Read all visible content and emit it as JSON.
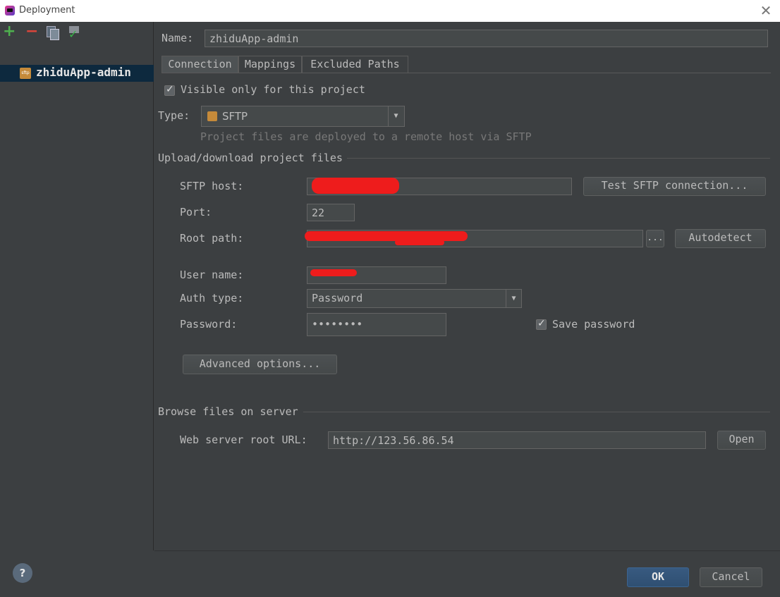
{
  "window": {
    "title": "Deployment",
    "close_glyph": "✕"
  },
  "left": {
    "toolbar": [
      "add-icon",
      "remove-icon",
      "copy-icon",
      "use-as-default-icon"
    ],
    "server_item": {
      "label": "zhiduApp-admin",
      "icon": "sftp-server-icon",
      "icon_text": "sftp"
    }
  },
  "name": {
    "label": "Name:",
    "value": "zhiduApp-admin"
  },
  "tabs": [
    {
      "label": "Connection",
      "active": true
    },
    {
      "label": "Mappings",
      "active": false
    },
    {
      "label": "Excluded Paths",
      "active": false
    }
  ],
  "connection": {
    "visible_only": {
      "label": "Visible only for this project",
      "checked": true
    },
    "type": {
      "label": "Type:",
      "value": "SFTP",
      "description": "Project files are deployed to a remote host via SFTP"
    },
    "upload_section": "Upload/download project files",
    "sftp_host": {
      "label": "SFTP host:",
      "value": ""
    },
    "test_button": "Test SFTP connection...",
    "port": {
      "label": "Port:",
      "value": "22"
    },
    "root_path": {
      "label": "Root path:",
      "value": "",
      "browse": "..."
    },
    "autodetect_button": "Autodetect",
    "user_name": {
      "label": "User name:",
      "value": ""
    },
    "auth_type": {
      "label": "Auth type:",
      "value": "Password"
    },
    "password": {
      "label": "Password:",
      "value": "••••••••"
    },
    "save_password": {
      "label": "Save password",
      "checked": true
    },
    "advanced_button": "Advanced options...",
    "browse_section": "Browse files on server",
    "web_root": {
      "label": "Web server root URL:",
      "value": "http://123.56.86.54"
    },
    "open_button": "Open"
  },
  "footer": {
    "help": "?",
    "ok": "OK",
    "cancel": "Cancel"
  },
  "colors": {
    "background": "#3c3f41",
    "selection": "#0d293e",
    "redaction": "#ee1c1c",
    "ok_button": "#365880"
  }
}
